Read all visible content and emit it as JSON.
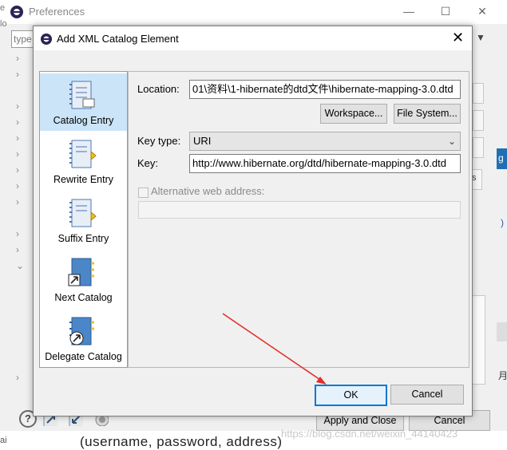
{
  "pref_window": {
    "title": "Preferences",
    "filter_placeholder": "type",
    "help_label": "?",
    "apply_close_label": "Apply and Close",
    "cancel_label": "Cancel",
    "bottom_text": "(username, password, address)",
    "watermark": "https://blog.csdn.net/weixin_44140423",
    "side_fragments": [
      "s",
      "g",
      ")",
      "月"
    ]
  },
  "dialog": {
    "title": "Add XML Catalog Element",
    "entry_types": [
      {
        "label": "Catalog Entry",
        "selected": true
      },
      {
        "label": "Rewrite Entry",
        "selected": false
      },
      {
        "label": "Suffix Entry",
        "selected": false
      },
      {
        "label": "Next Catalog",
        "selected": false
      },
      {
        "label": "Delegate Catalog",
        "selected": false
      }
    ],
    "location_label": "Location:",
    "location_value": "01\\资料\\1-hibernate的dtd文件\\hibernate-mapping-3.0.dtd",
    "workspace_button": "Workspace...",
    "file_system_button": "File System...",
    "key_type_label": "Key type:",
    "key_type_value": "URI",
    "key_label": "Key:",
    "key_value": "http://www.hibernate.org/dtd/hibernate-mapping-3.0.dtd",
    "alt_web_label": "Alternative web address:",
    "alt_web_value": "",
    "ok_button": "OK",
    "cancel_button": "Cancel"
  },
  "colors": {
    "selection": "#cce4f7",
    "ok_border": "#0078d7",
    "arrow": "#e0302a"
  }
}
